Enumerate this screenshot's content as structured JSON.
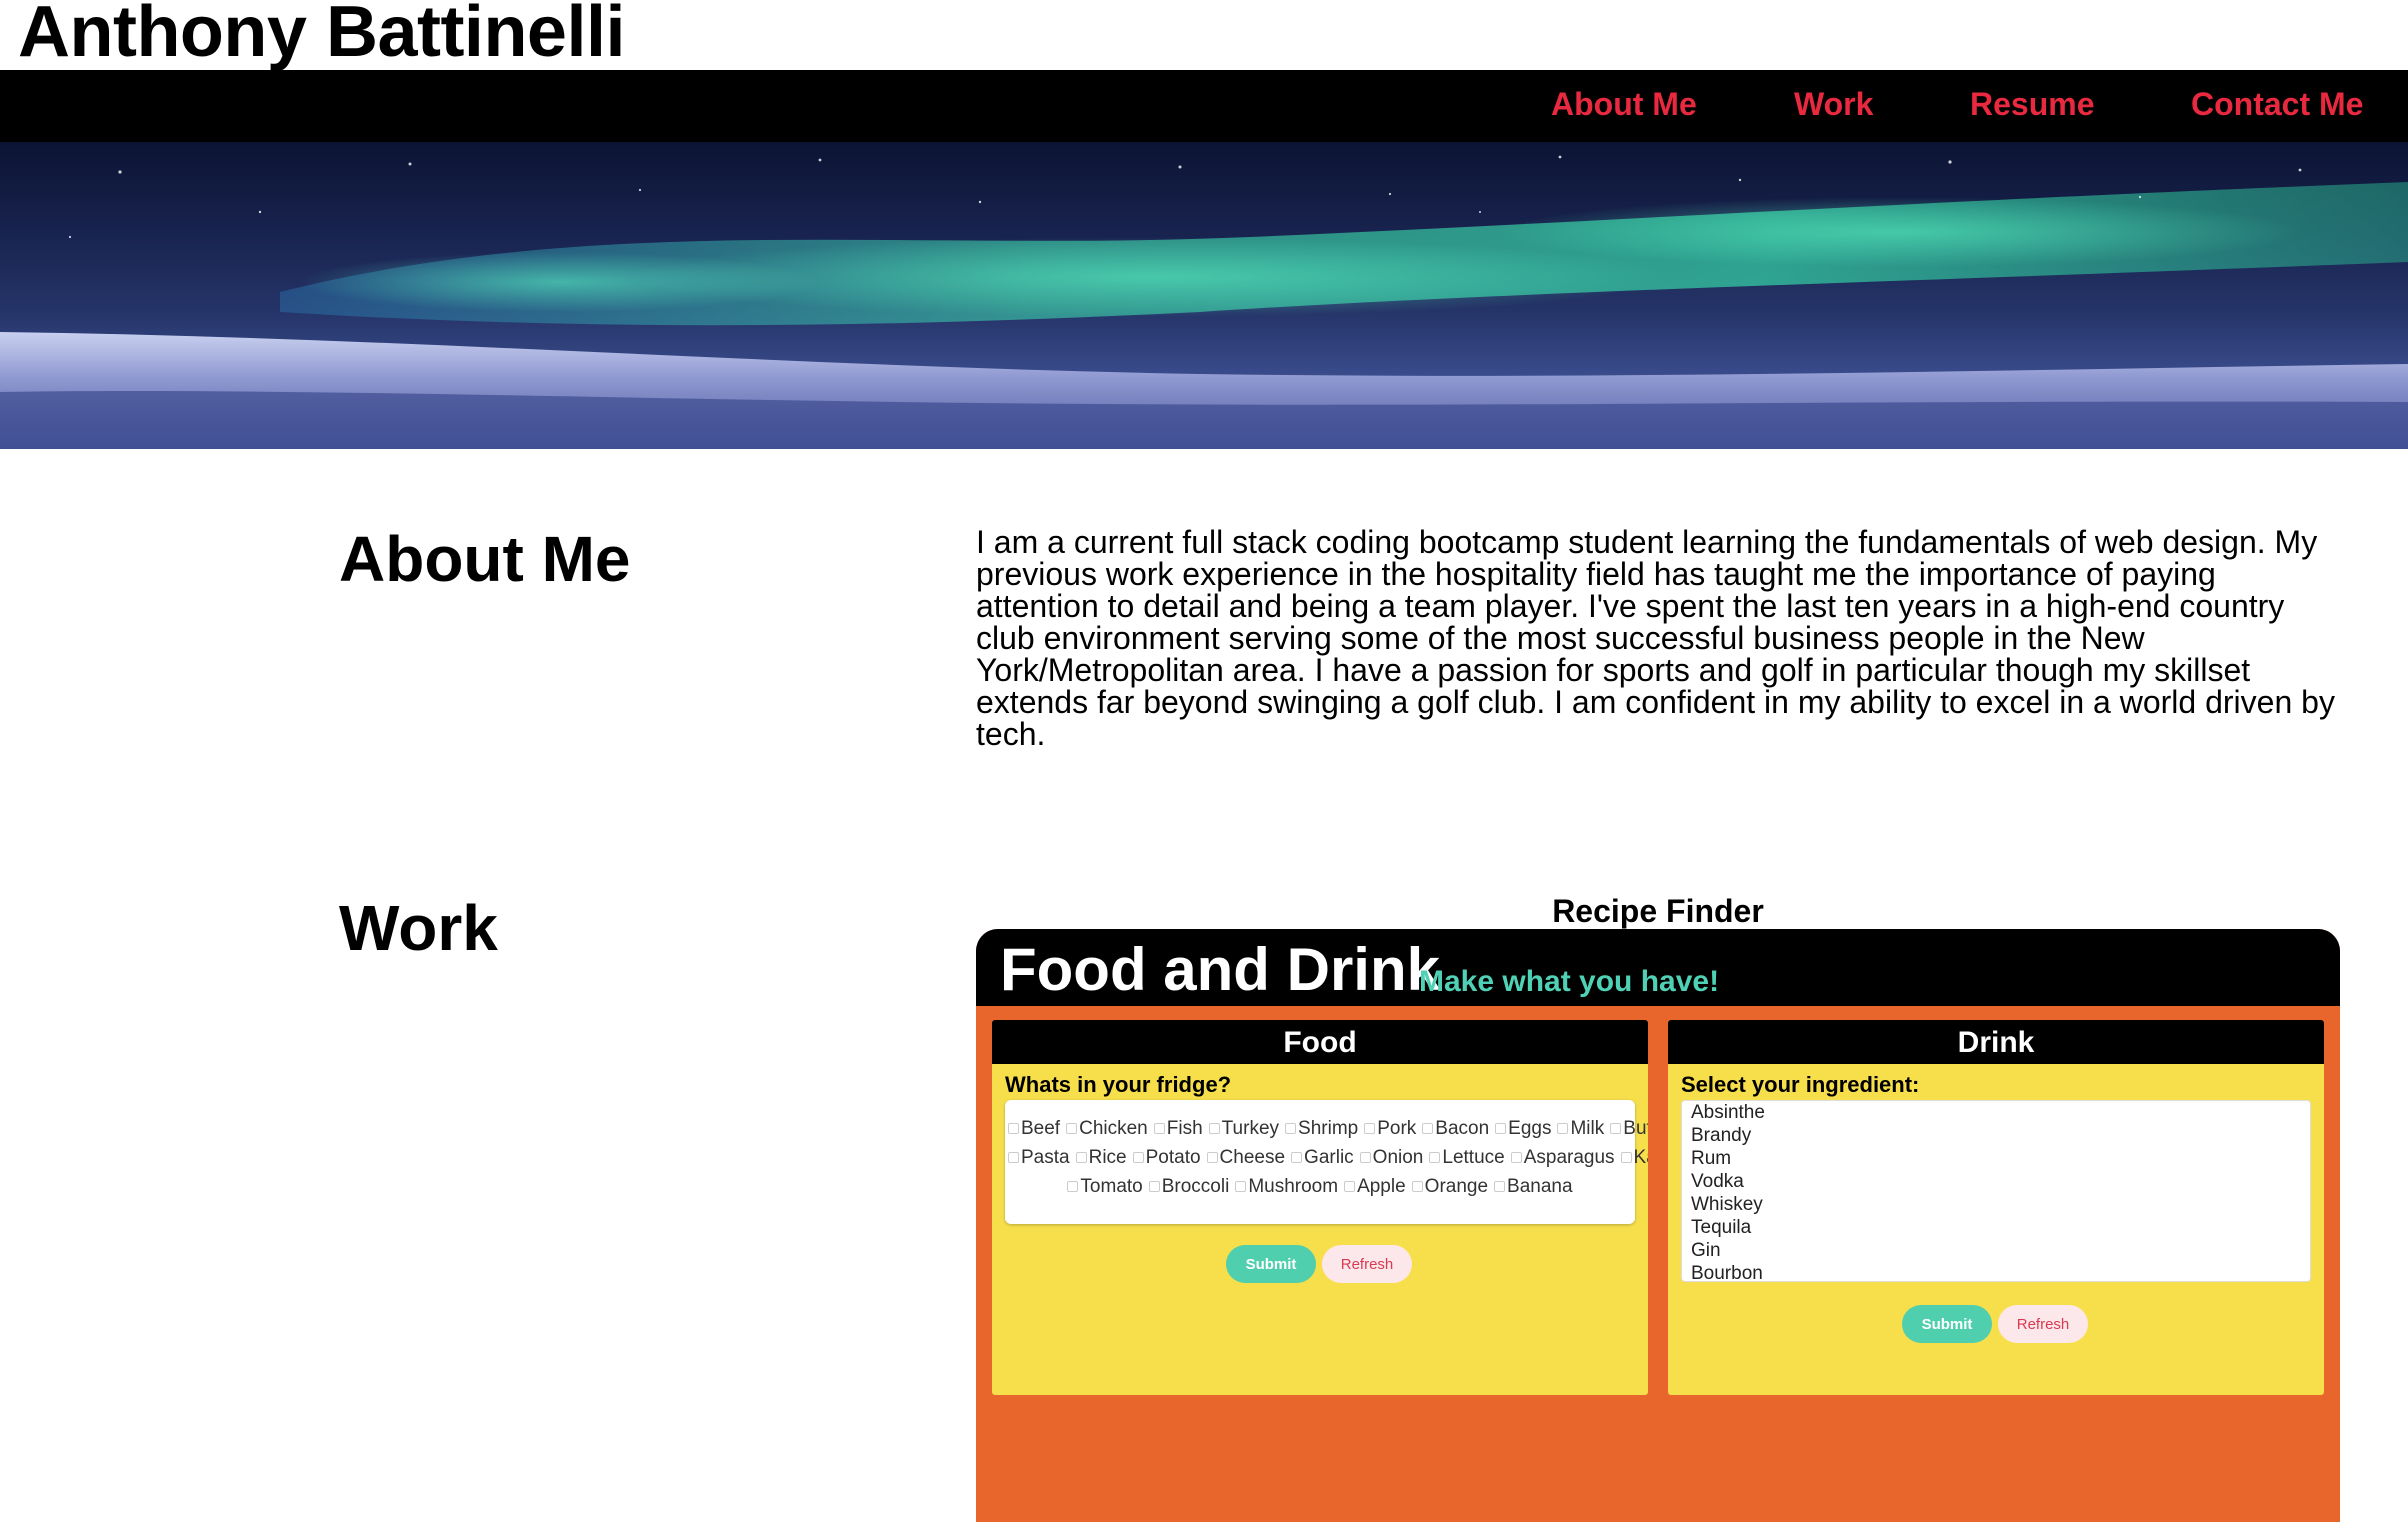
{
  "site": {
    "title": "Anthony Battinelli"
  },
  "nav": {
    "items": [
      {
        "label": "About Me"
      },
      {
        "label": "Work"
      },
      {
        "label": "Resume"
      },
      {
        "label": "Contact Me"
      }
    ]
  },
  "about": {
    "heading": "About Me",
    "text": "I am a current full stack coding bootcamp student learning the fundamentals of web design. My previous work experience in the hospitality field has taught me the importance of paying attention to detail and being a team player. I've spent the last ten years in a high-end country club environment serving some of the most successful business people in the New York/Metropolitan area. I have a passion for sports and golf in particular though my skillset extends far beyond swinging a golf club. I am confident in my ability to excel in a world driven by tech."
  },
  "work": {
    "heading": "Work",
    "project_title": "Recipe Finder",
    "app": {
      "name": "Food and Drink",
      "tagline": "Make what you have!",
      "food": {
        "header": "Food",
        "label": "Whats in your fridge?",
        "ingredients_rows": [
          [
            "Beef",
            "Chicken",
            "Fish",
            "Turkey",
            "Shrimp",
            "Pork",
            "Bacon",
            "Eggs",
            "Milk",
            "Butter"
          ],
          [
            "Pasta",
            "Rice",
            "Potato",
            "Cheese",
            "Garlic",
            "Onion",
            "Lettuce",
            "Asparagus",
            "Kale"
          ],
          [
            "Tomato",
            "Broccoli",
            "Mushroom",
            "Apple",
            "Orange",
            "Banana"
          ]
        ],
        "submit_label": "Submit",
        "refresh_label": "Refresh"
      },
      "drink": {
        "header": "Drink",
        "label": "Select your ingredient:",
        "options": [
          "Absinthe",
          "Brandy",
          "Rum",
          "Vodka",
          "Whiskey",
          "Tequila",
          "Gin",
          "Bourbon"
        ],
        "submit_label": "Submit",
        "refresh_label": "Refresh"
      }
    }
  },
  "colors": {
    "nav_link": "#e8293f",
    "app_background": "#e8652b",
    "panel_background": "#f7df4c",
    "tagline": "#4fd1b5",
    "submit": "#4fcfae",
    "refresh": "#fce8ea"
  }
}
